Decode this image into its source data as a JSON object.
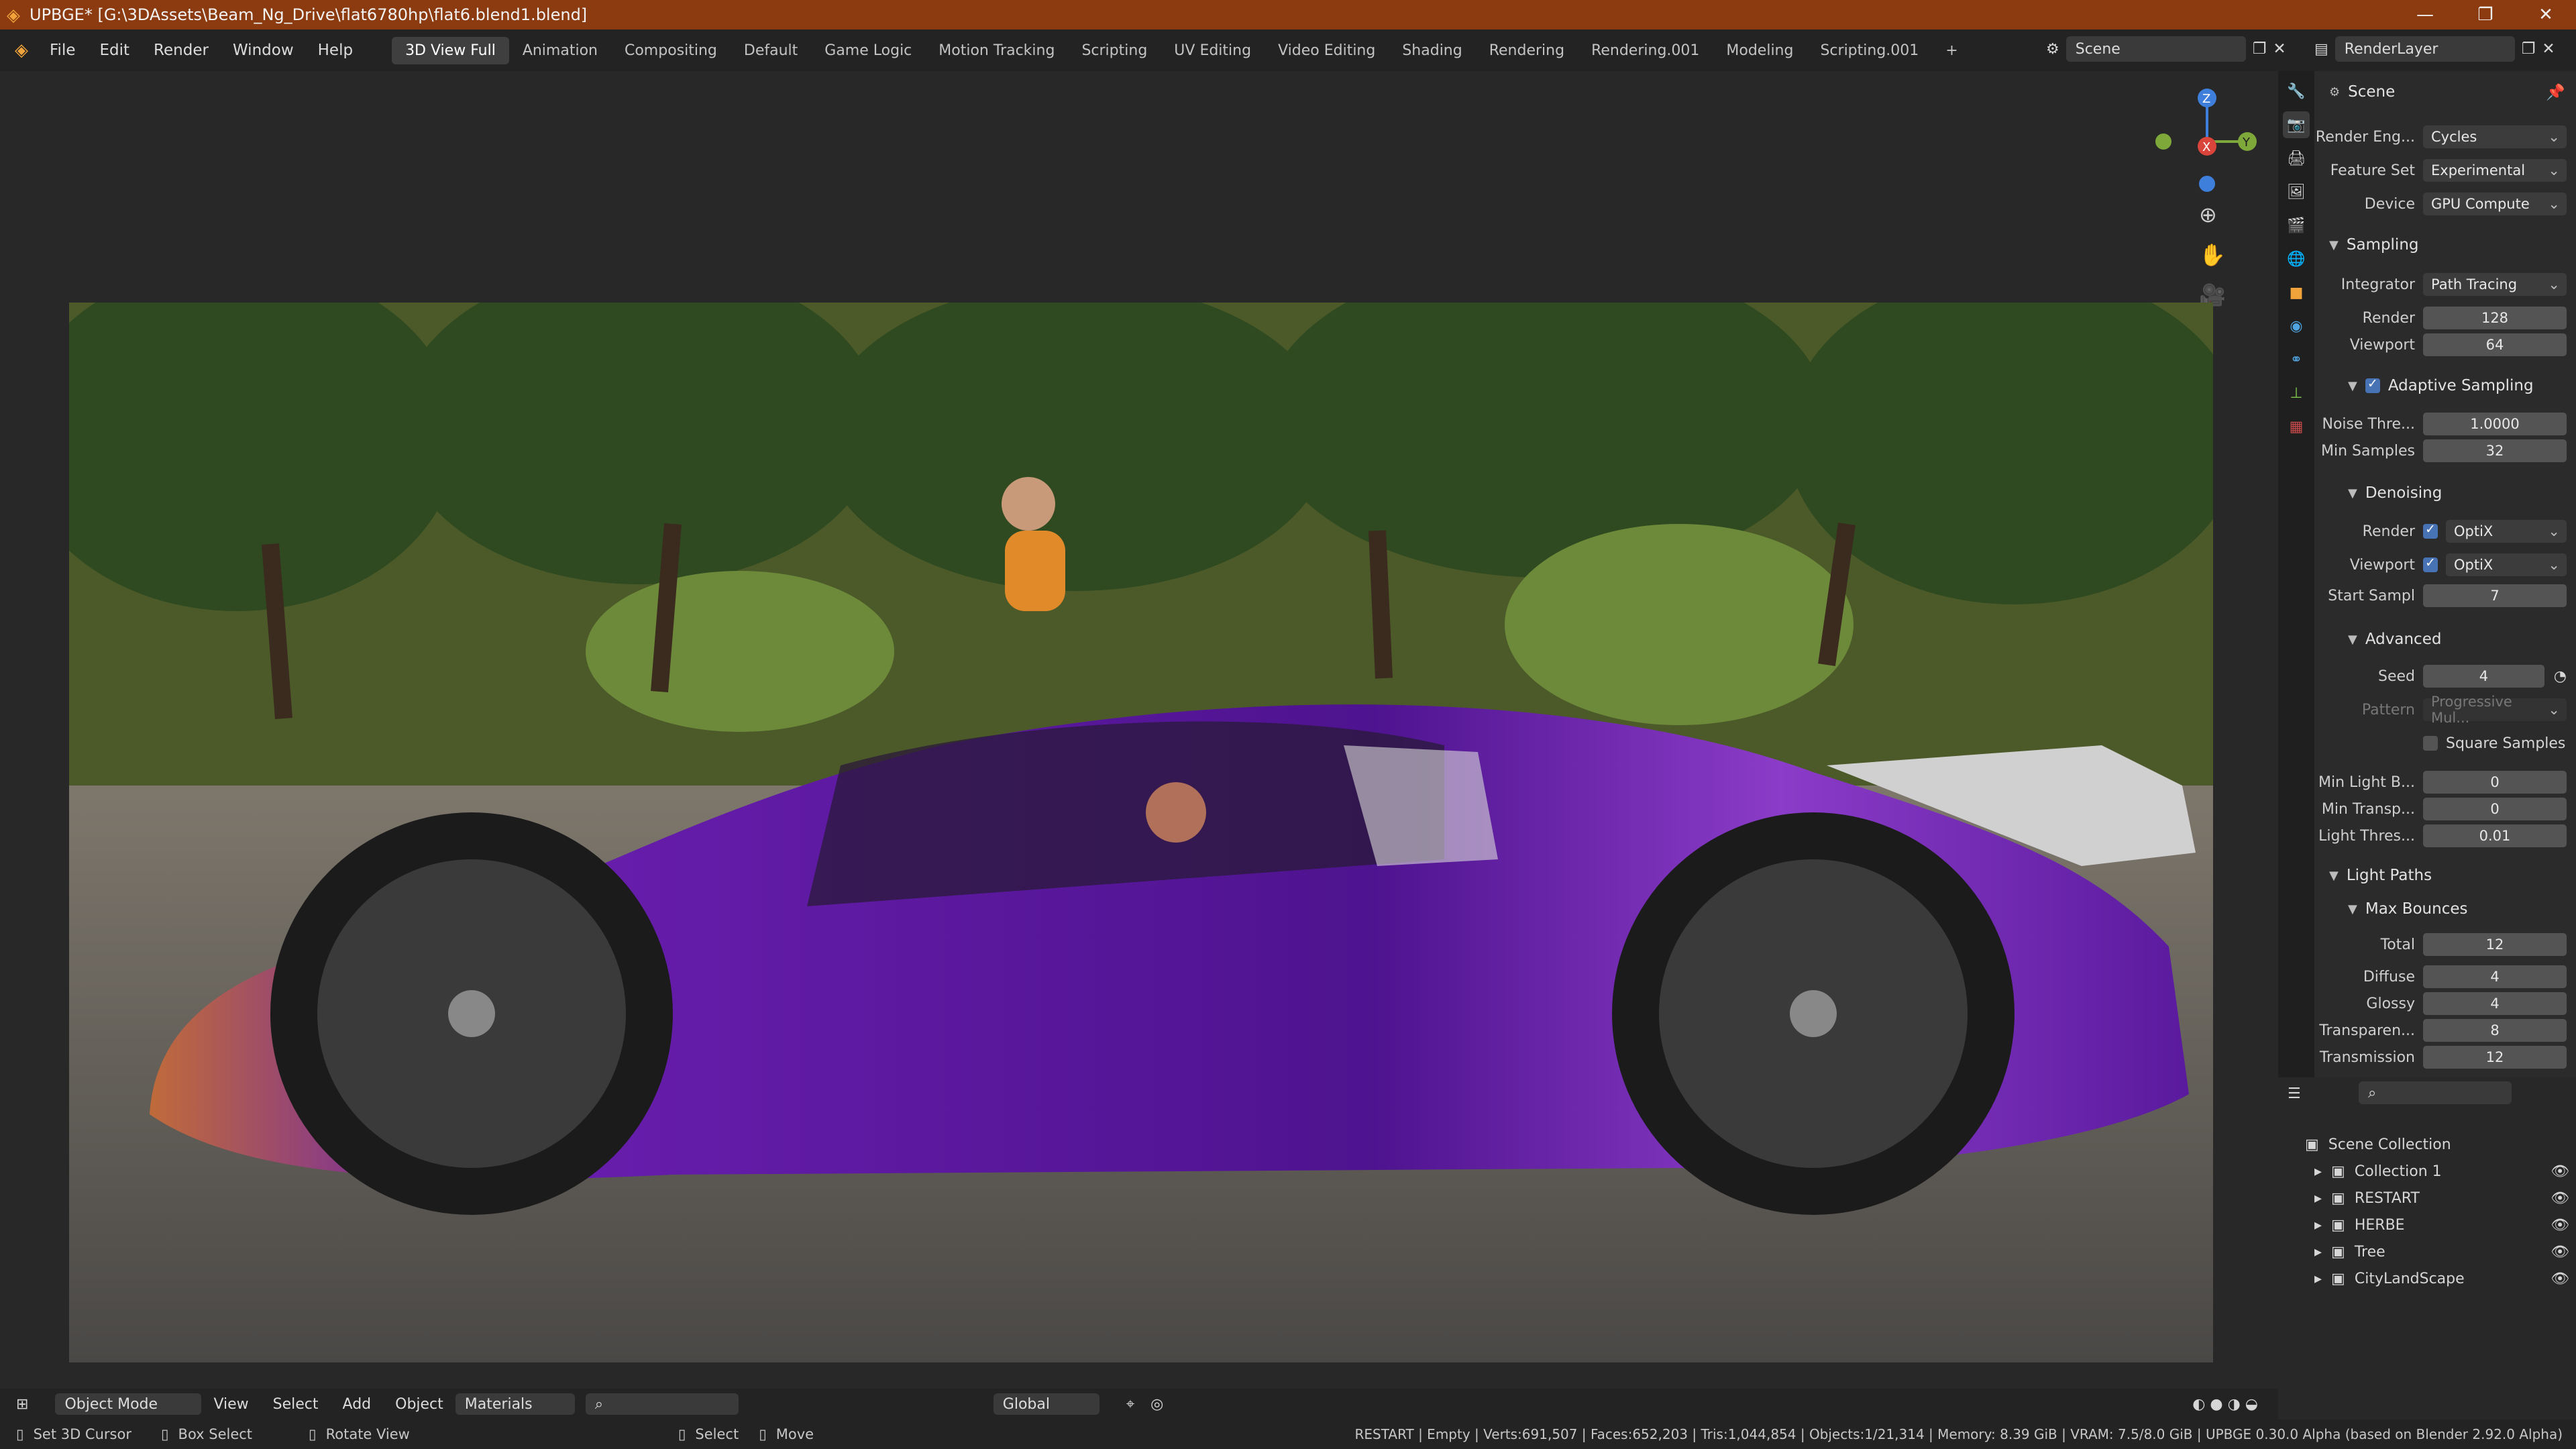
{
  "titlebar": {
    "title": "UPBGE* [G:\\3DAssets\\Beam_Ng_Drive\\flat6780hp\\flat6.blend1.blend]"
  },
  "menus": [
    "File",
    "Edit",
    "Render",
    "Window",
    "Help"
  ],
  "workspaces": [
    "3D View Full",
    "Animation",
    "Compositing",
    "Default",
    "Game Logic",
    "Motion Tracking",
    "Scripting",
    "UV Editing",
    "Video Editing",
    "Shading",
    "Rendering",
    "Rendering.001",
    "Modeling",
    "Scripting.001"
  ],
  "active_workspace": "3D View Full",
  "scene_field": "Scene",
  "layer_field": "RenderLayer",
  "props": {
    "header": "Scene",
    "render_engine_label": "Render Eng...",
    "render_engine": "Cycles",
    "feature_set_label": "Feature Set",
    "feature_set": "Experimental",
    "device_label": "Device",
    "device": "GPU Compute",
    "sampling": "Sampling",
    "integrator_label": "Integrator",
    "integrator": "Path Tracing",
    "render_label": "Render",
    "render": "128",
    "viewport_label": "Viewport",
    "viewport": "64",
    "adaptive": "Adaptive Sampling",
    "noise_label": "Noise Thre...",
    "noise": "1.0000",
    "minsamples_label": "Min Samples",
    "minsamples": "32",
    "denoising": "Denoising",
    "den_render_label": "Render",
    "den_render": "OptiX",
    "den_viewport_label": "Viewport",
    "den_viewport": "OptiX",
    "startsampl_label": "Start Sampl",
    "startsampl": "7",
    "advanced": "Advanced",
    "seed_label": "Seed",
    "seed": "4",
    "pattern_label": "Pattern",
    "pattern": "Progressive Mul...",
    "square": "Square Samples",
    "minlight_label": "Min Light B...",
    "minlight": "0",
    "mintransp_label": "Min Transp...",
    "mintransp": "0",
    "lightthres_label": "Light Thres...",
    "lightthres": "0.01",
    "lightpaths": "Light Paths",
    "maxbounces": "Max Bounces",
    "total_label": "Total",
    "total": "12",
    "diffuse_label": "Diffuse",
    "diffuse": "4",
    "glossy_label": "Glossy",
    "glossy": "4",
    "transparency_label": "Transparen...",
    "transparency": "8",
    "transmission_label": "Transmission",
    "transmission": "12"
  },
  "outliner": {
    "root": "Scene Collection",
    "items": [
      "Collection 1",
      "RESTART",
      "HERBE",
      "Tree",
      "CityLandScape"
    ]
  },
  "bottom": {
    "mode": "Object Mode",
    "view": "View",
    "select": "Select",
    "add": "Add",
    "object": "Object",
    "shading": "Materials",
    "orientation": "Global"
  },
  "status": {
    "set_cursor": "Set 3D Cursor",
    "box_select": "Box Select",
    "rotate": "Rotate View",
    "select": "Select",
    "move": "Move",
    "stats": "RESTART | Empty | Verts:691,507 | Faces:652,203 | Tris:1,044,854 | Objects:1/21,314 | Memory: 8.39 GiB | VRAM: 7.5/8.0 GiB | UPBGE 0.30.0 Alpha (based on Blender 2.92.0 Alpha)"
  },
  "colors": {
    "accent": "#4772b3",
    "titlebar": "#8b3b0f",
    "car": "#5a1a9e"
  }
}
